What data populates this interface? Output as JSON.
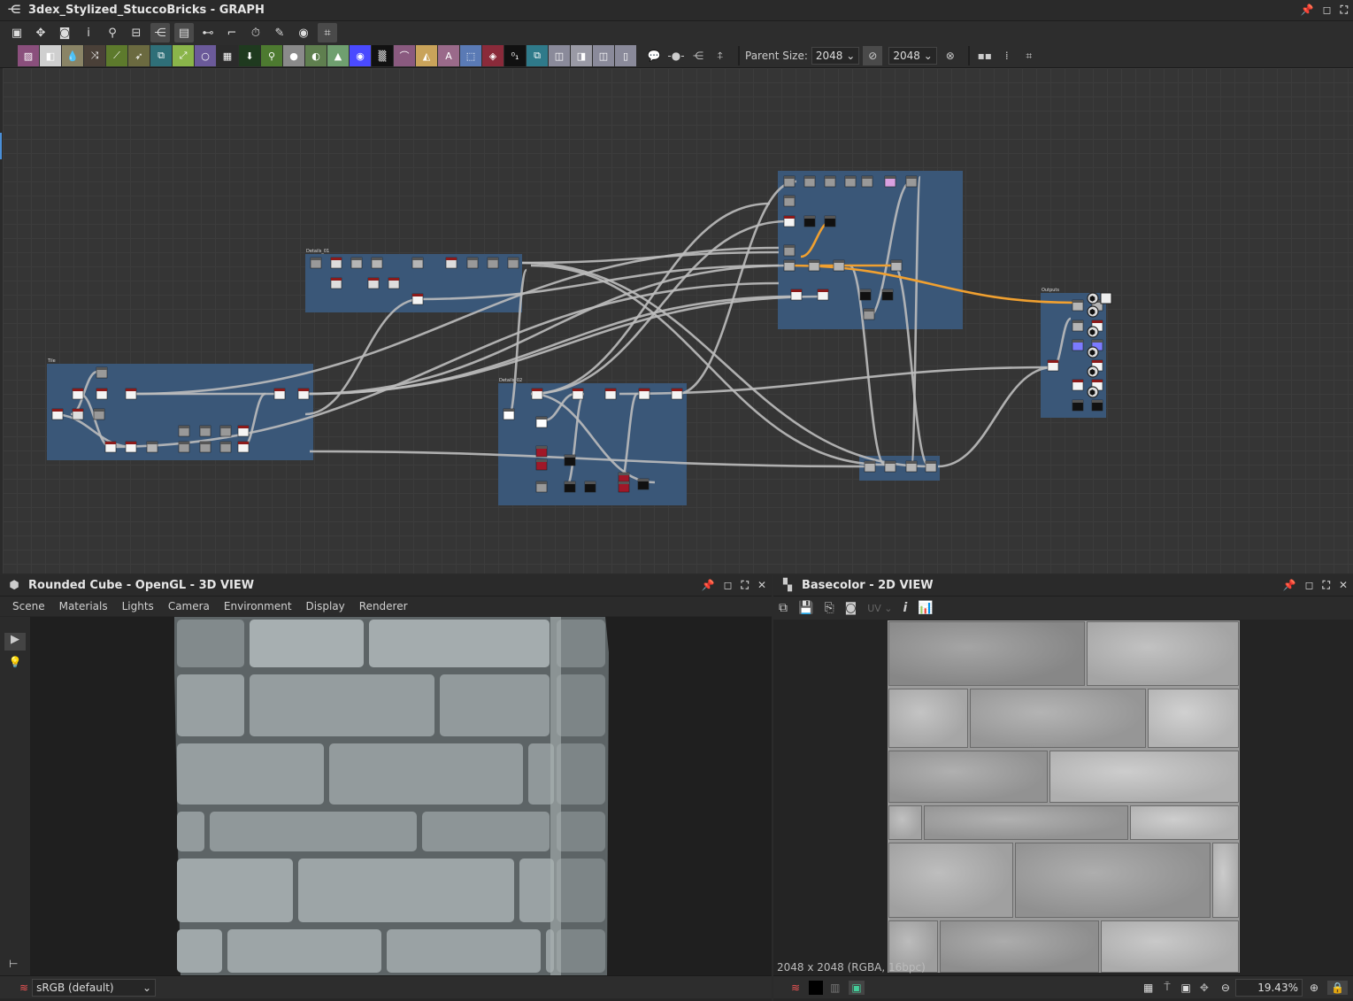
{
  "graph": {
    "title": "3dex_Stylized_StuccoBricks - GRAPH",
    "toolbar1": [
      {
        "name": "frame-all-icon",
        "glyph": "▣"
      },
      {
        "name": "fit-1-1-icon",
        "glyph": "✥"
      },
      {
        "name": "camera-icon",
        "glyph": "◙"
      },
      {
        "name": "info-icon",
        "glyph": "i"
      },
      {
        "name": "search-icon",
        "glyph": "⚲"
      },
      {
        "name": "node-align-icon",
        "glyph": "⊟"
      },
      {
        "name": "graph-layout-icon",
        "glyph": "⋲",
        "on": true
      },
      {
        "name": "frames-icon",
        "glyph": "▤",
        "on": true
      },
      {
        "name": "link-style-icon",
        "glyph": "⊷"
      },
      {
        "name": "connector-icon",
        "glyph": "⌐"
      },
      {
        "name": "timer-icon",
        "glyph": "⏱"
      },
      {
        "name": "tools-icon",
        "glyph": "✎"
      },
      {
        "name": "preview-icon",
        "glyph": "◉"
      },
      {
        "name": "grid-snap-icon",
        "glyph": "⌗",
        "on": true
      }
    ],
    "toolbar2": [
      {
        "name": "bitmap-node-icon",
        "color": "#8a4f7c",
        "glyph": "▨"
      },
      {
        "name": "blend-node-icon",
        "color": "#cfcfcf",
        "glyph": "◧"
      },
      {
        "name": "blur-node-icon",
        "color": "#8a8466",
        "glyph": "💧"
      },
      {
        "name": "shuffle-node-icon",
        "color": "#4a4038",
        "glyph": "⤨"
      },
      {
        "name": "curve-node-icon",
        "color": "#5d7a2c",
        "glyph": "⟋"
      },
      {
        "name": "directional-warp-icon",
        "color": "#6b6a40",
        "glyph": "➶"
      },
      {
        "name": "warp-node-icon",
        "color": "#2f6f78",
        "glyph": "⧉"
      },
      {
        "name": "gradient-node-icon",
        "color": "#8ab54a",
        "glyph": "⤢"
      },
      {
        "name": "shape-node-icon",
        "color": "#6b5a9a",
        "glyph": "○"
      },
      {
        "name": "tile-node-icon",
        "color": "#2b2b2b",
        "glyph": "▦"
      },
      {
        "name": "transform-node-icon",
        "color": "#1f3a1f",
        "glyph": "⬇"
      },
      {
        "name": "fx-map-icon",
        "color": "#4d7a30",
        "glyph": "⚲"
      },
      {
        "name": "value-node-icon",
        "color": "#8a8a8a",
        "glyph": "●"
      },
      {
        "name": "levels-node-icon",
        "color": "#5f7f4f",
        "glyph": "◐"
      },
      {
        "name": "histogram-node-icon",
        "color": "#6f9f6f",
        "glyph": "▲"
      },
      {
        "name": "hsl-node-icon",
        "color": "#4a4aff",
        "glyph": "◉"
      },
      {
        "name": "noise-node-icon",
        "color": "#111111",
        "glyph": "▒"
      },
      {
        "name": "spline-node-icon",
        "color": "#8a5a7f",
        "glyph": "⌒"
      },
      {
        "name": "mirror-node-icon",
        "color": "#c9a35a",
        "glyph": "◭"
      },
      {
        "name": "text-node-icon",
        "color": "#9a6a8a",
        "glyph": "A"
      },
      {
        "name": "selection-node-icon",
        "color": "#5a7ab5",
        "glyph": "⬚"
      },
      {
        "name": "fill-node-icon",
        "color": "#8a2a3a",
        "glyph": "◈"
      },
      {
        "name": "pixel-processor-icon",
        "color": "#111111",
        "glyph": "⁰₁"
      },
      {
        "name": "normal-node-icon",
        "color": "#2f7a8a",
        "glyph": "⧉"
      },
      {
        "name": "input-color-icon",
        "color": "#8a8a9a",
        "glyph": "◫"
      },
      {
        "name": "input-gray-icon",
        "color": "#9a9aa5",
        "glyph": "◨"
      },
      {
        "name": "input-func-icon",
        "color": "#8a8a9a",
        "glyph": "◫"
      },
      {
        "name": "output-node-icon",
        "color": "#8a8a9a",
        "glyph": "▯"
      }
    ],
    "toolbar2_extra": [
      {
        "name": "comment-icon",
        "glyph": "💬"
      },
      {
        "name": "pin-dot-icon",
        "glyph": "-●-"
      },
      {
        "name": "graph-node-icon",
        "glyph": "⋲"
      },
      {
        "name": "pin-icon",
        "glyph": "⍏"
      }
    ],
    "parent_size_label": "Parent Size:",
    "width_value": "2048",
    "height_value": "2048",
    "frames": [
      {
        "label": "Details_01"
      },
      {
        "label": "Tile"
      },
      {
        "label": "Details_02"
      },
      {
        "label": ""
      },
      {
        "label": "Outputs"
      },
      {
        "label": ""
      }
    ],
    "colors": {
      "frame": "#3b5a7e",
      "wire": "#bdbdbd",
      "wire_active": "#f0a030"
    }
  },
  "view3d": {
    "title": "Rounded Cube - OpenGL - 3D VIEW",
    "menu": [
      "Scene",
      "Materials",
      "Lights",
      "Camera",
      "Environment",
      "Display",
      "Renderer"
    ],
    "colorspace": "sRGB (default)"
  },
  "view2d": {
    "title": "Basecolor - 2D VIEW",
    "uv_label": "UV",
    "image_info": "2048 x 2048 (RGBA, 16bpc)",
    "zoom": "19.43%"
  }
}
